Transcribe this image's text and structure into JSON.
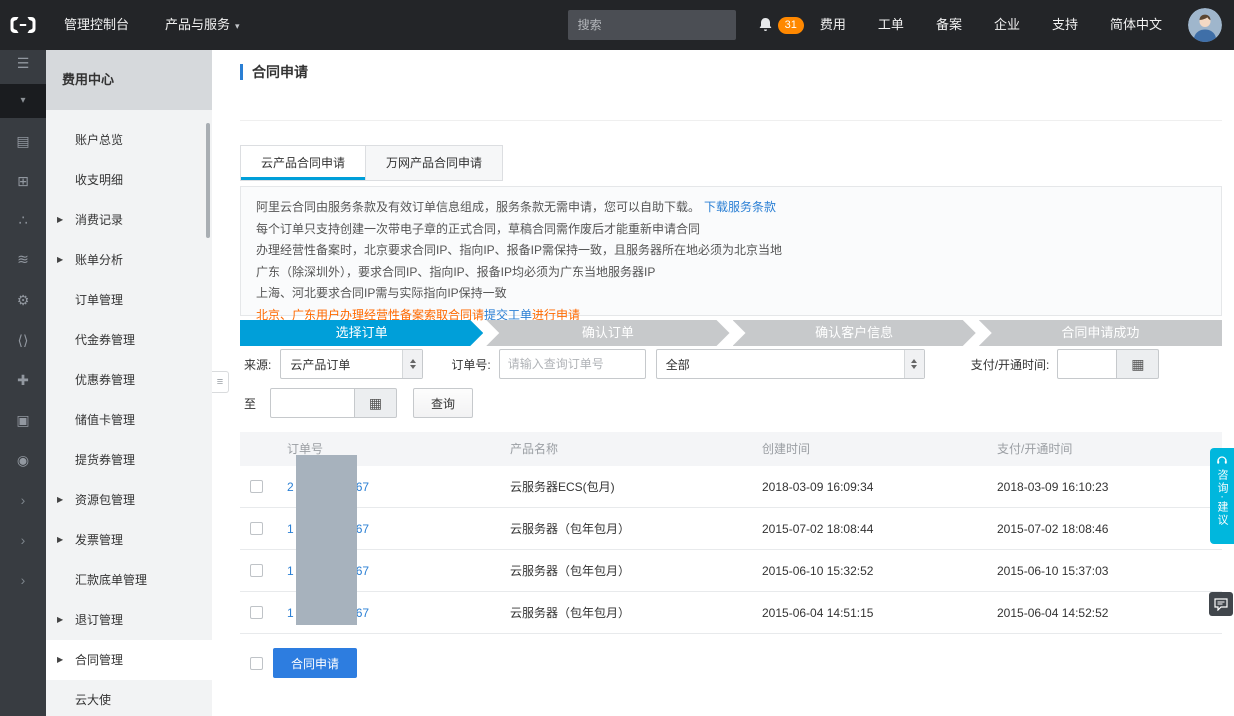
{
  "topnav": {
    "console": "管理控制台",
    "products": "产品与服务",
    "search_placeholder": "搜索",
    "notification_count": "31",
    "billing": "费用",
    "tickets": "工单",
    "icp": "备案",
    "enterprise": "企业",
    "support": "支持",
    "language": "简体中文"
  },
  "sidebar": {
    "title": "费用中心",
    "items": [
      {
        "label": "账户总览",
        "expandable": false,
        "active": false
      },
      {
        "label": "收支明细",
        "expandable": false,
        "active": false
      },
      {
        "label": "消费记录",
        "expandable": true,
        "active": false
      },
      {
        "label": "账单分析",
        "expandable": true,
        "active": false
      },
      {
        "label": "订单管理",
        "expandable": false,
        "active": false
      },
      {
        "label": "代金券管理",
        "expandable": false,
        "active": false
      },
      {
        "label": "优惠券管理",
        "expandable": false,
        "active": false
      },
      {
        "label": "储值卡管理",
        "expandable": false,
        "active": false
      },
      {
        "label": "提货券管理",
        "expandable": false,
        "active": false
      },
      {
        "label": "资源包管理",
        "expandable": true,
        "active": false
      },
      {
        "label": "发票管理",
        "expandable": true,
        "active": false
      },
      {
        "label": "汇款底单管理",
        "expandable": false,
        "active": false
      },
      {
        "label": "退订管理",
        "expandable": true,
        "active": false
      },
      {
        "label": "合同管理",
        "expandable": true,
        "active": true
      },
      {
        "label": "云大使",
        "expandable": false,
        "active": false
      }
    ]
  },
  "page": {
    "title": "合同申请"
  },
  "tabs": [
    {
      "label": "云产品合同申请",
      "active": true
    },
    {
      "label": "万网产品合同申请",
      "active": false
    }
  ],
  "notice": {
    "line1_text": "阿里云合同由服务条款及有效订单信息组成，服务条款无需申请，您可以自助下载。",
    "line1_link": "下载服务条款",
    "line2": "每个订单只支持创建一次带电子章的正式合同，草稿合同需作废后才能重新申请合同",
    "line3": "办理经营性备案时，北京要求合同IP、指向IP、报备IP需保持一致，且服务器所在地必须为北京当地",
    "line4": "广东（除深圳外），要求合同IP、指向IP、报备IP均必须为广东当地服务器IP",
    "line5": "上海、河北要求合同IP需与实际指向IP保持一致",
    "line6_text": "北京、广东用户办理经营性备案索取合同请",
    "line6_link": "提交工单",
    "line6_suffix": "进行申请"
  },
  "steps": [
    {
      "label": "选择订单",
      "active": true
    },
    {
      "label": "确认订单",
      "active": false
    },
    {
      "label": "确认客户信息",
      "active": false
    },
    {
      "label": "合同申请成功",
      "active": false
    }
  ],
  "filters": {
    "source_label": "来源:",
    "source_value": "云产品订单",
    "order_label": "订单号:",
    "order_placeholder": "请输入查询订单号",
    "status_value": "全部",
    "time_label": "支付/开通时间:",
    "to_label": "至",
    "search_button": "查询"
  },
  "table": {
    "headers": [
      "订单号",
      "产品名称",
      "创建时间",
      "支付/开通时间"
    ],
    "rows": [
      {
        "order_prefix": "2",
        "order_suffix": "67",
        "product": "云服务器ECS(包月)",
        "created": "2018-03-09 16:09:34",
        "paid": "2018-03-09 16:10:23"
      },
      {
        "order_prefix": "1",
        "order_suffix": "67",
        "product": "云服务器（包年包月）",
        "created": "2015-07-02 18:08:44",
        "paid": "2015-07-02 18:08:46"
      },
      {
        "order_prefix": "1",
        "order_suffix": "67",
        "product": "云服务器（包年包月）",
        "created": "2015-06-10 15:32:52",
        "paid": "2015-06-10 15:37:03"
      },
      {
        "order_prefix": "1",
        "order_suffix": "67",
        "product": "云服务器（包年包月）",
        "created": "2015-06-04 14:51:15",
        "paid": "2015-06-04 14:52:52"
      }
    ],
    "apply_button": "合同申请"
  },
  "feedback_tab": "咨询·建议",
  "strip_icons": [
    {
      "name": "menu",
      "glyph": "☰"
    },
    {
      "name": "caret-down",
      "glyph": "▾"
    },
    {
      "name": "bill",
      "glyph": "▤"
    },
    {
      "name": "gift",
      "glyph": "⊞"
    },
    {
      "name": "nodes",
      "glyph": "∴"
    },
    {
      "name": "storage",
      "glyph": "≋"
    },
    {
      "name": "gear",
      "glyph": "⚙"
    },
    {
      "name": "code",
      "glyph": "⟨⟩"
    },
    {
      "name": "plus",
      "glyph": "✚"
    },
    {
      "name": "monitor",
      "glyph": "▣"
    },
    {
      "name": "eye",
      "glyph": "◉"
    },
    {
      "name": "chevron-1",
      "glyph": "›"
    },
    {
      "name": "chevron-2",
      "glyph": "›"
    },
    {
      "name": "chevron-3",
      "glyph": "›"
    }
  ],
  "icons": {
    "caret_down": "▾",
    "calendar": "▦",
    "collapse": "≡",
    "expand_arrow": "▶"
  },
  "colors": {
    "accent": "#009fd9",
    "link": "#2a7fd4",
    "primary_button": "#2d7de0",
    "warning_text": "#ff6a00",
    "badge": "#ff8800",
    "redaction": "#a7b2bd",
    "feedback": "#00b7dd"
  }
}
